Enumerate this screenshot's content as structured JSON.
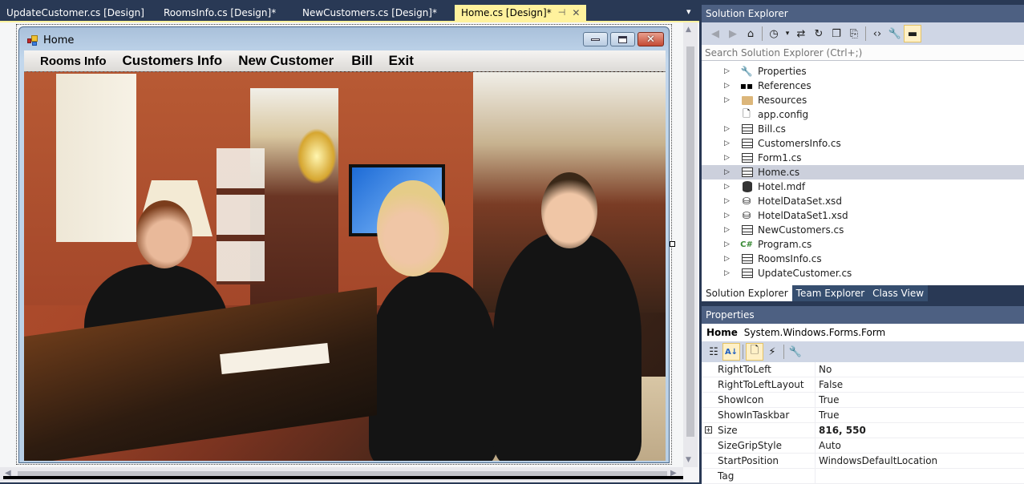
{
  "doc_tabs": [
    {
      "label": "UpdateCustomer.cs [Design]",
      "active": false
    },
    {
      "label": "RoomsInfo.cs [Design]*",
      "active": false
    },
    {
      "label": "NewCustomers.cs [Design]*",
      "active": false
    },
    {
      "label": "Home.cs [Design]*",
      "active": true
    }
  ],
  "icons": {
    "pin": "⊣",
    "close": "✕",
    "dropdown": "▾",
    "expand": "▷",
    "plus": "+"
  },
  "form": {
    "title": "Home",
    "menu": [
      "Rooms Info",
      "Customers Info",
      "New Customer",
      "Bill",
      "Exit"
    ],
    "caption_buttons": [
      "minimize",
      "maximize",
      "close"
    ]
  },
  "solution_explorer": {
    "title": "Solution Explorer",
    "search_placeholder": "Search Solution Explorer (Ctrl+;)",
    "toolbar": [
      "back",
      "forward",
      "home",
      "pending-changes",
      "sync",
      "refresh",
      "collapse-all",
      "show-all-files",
      "view-code",
      "properties",
      "preview"
    ],
    "items": [
      {
        "label": "Properties",
        "icon": "wrench",
        "expandable": true
      },
      {
        "label": "References",
        "icon": "references",
        "expandable": true
      },
      {
        "label": "Resources",
        "icon": "folder",
        "expandable": true
      },
      {
        "label": "app.config",
        "icon": "config",
        "expandable": false
      },
      {
        "label": "Bill.cs",
        "icon": "form",
        "expandable": true
      },
      {
        "label": "CustomersInfo.cs",
        "icon": "form",
        "expandable": true
      },
      {
        "label": "Form1.cs",
        "icon": "form",
        "expandable": true
      },
      {
        "label": "Home.cs",
        "icon": "form",
        "expandable": true,
        "selected": true
      },
      {
        "label": "Hotel.mdf",
        "icon": "database",
        "expandable": true
      },
      {
        "label": "HotelDataSet.xsd",
        "icon": "dataset",
        "expandable": true
      },
      {
        "label": "HotelDataSet1.xsd",
        "icon": "dataset",
        "expandable": true
      },
      {
        "label": "NewCustomers.cs",
        "icon": "form",
        "expandable": true
      },
      {
        "label": "Program.cs",
        "icon": "csharp",
        "expandable": true
      },
      {
        "label": "RoomsInfo.cs",
        "icon": "form",
        "expandable": true
      },
      {
        "label": "UpdateCustomer.cs",
        "icon": "form",
        "expandable": true
      }
    ]
  },
  "bottom_tabs": [
    {
      "label": "Solution Explorer",
      "active": true
    },
    {
      "label": "Team Explorer",
      "active": false
    },
    {
      "label": "Class View",
      "active": false
    }
  ],
  "properties": {
    "title": "Properties",
    "object_name": "Home",
    "object_type": "System.Windows.Forms.Form",
    "rows": [
      {
        "name": "RightToLeft",
        "value": "No"
      },
      {
        "name": "RightToLeftLayout",
        "value": "False"
      },
      {
        "name": "ShowIcon",
        "value": "True"
      },
      {
        "name": "ShowInTaskbar",
        "value": "True"
      },
      {
        "name": "Size",
        "value": "816, 550",
        "bold": true,
        "expandable": true
      },
      {
        "name": "SizeGripStyle",
        "value": "Auto"
      },
      {
        "name": "StartPosition",
        "value": "WindowsDefaultLocation"
      },
      {
        "name": "Tag",
        "value": ""
      }
    ]
  }
}
